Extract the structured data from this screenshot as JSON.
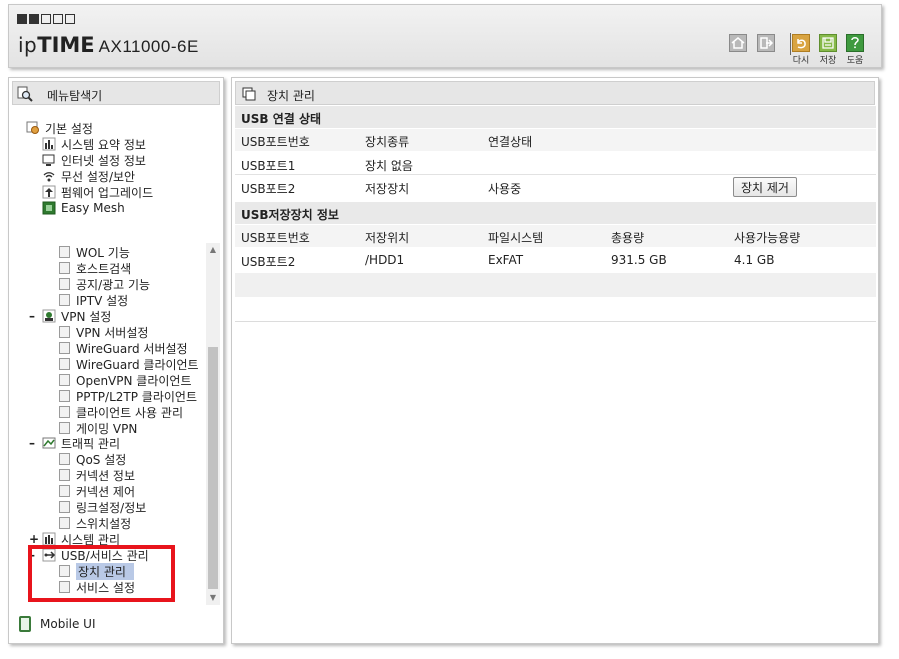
{
  "header": {
    "brand_ip": "ip",
    "brand_time": "TIME",
    "model": "AX11000-6E",
    "buttons": [
      {
        "name": "home",
        "icon": "home-icon"
      },
      {
        "name": "logout",
        "icon": "logout-icon"
      },
      {
        "name": "reload",
        "icon": "undo-icon",
        "label": "다시",
        "color": "#d9a441"
      },
      {
        "name": "save",
        "icon": "save-icon",
        "label": "저장",
        "color": "#86b94a"
      },
      {
        "name": "help",
        "icon": "help-icon",
        "label": "도움",
        "color": "#3f9a3f"
      }
    ]
  },
  "sidebar": {
    "title": "메뉴탐색기",
    "top_group": {
      "label": "기본 설정",
      "items": [
        "시스템 요약 정보",
        "인터넷 설정 정보",
        "무선 설정/보안",
        "펌웨어 업그레이드",
        "Easy Mesh"
      ]
    },
    "scroll": {
      "pre_items": [
        "WOL 기능",
        "호스트검색",
        "공지/광고 기능",
        "IPTV 설정"
      ],
      "vpn": {
        "label": "VPN 설정",
        "items": [
          "VPN 서버설정",
          "WireGuard 서버설정",
          "WireGuard 클라이언트",
          "OpenVPN 클라이언트",
          "PPTP/L2TP 클라이언트",
          "클라이언트 사용 관리",
          "게이밍 VPN"
        ]
      },
      "traffic": {
        "label": "트래픽 관리",
        "items": [
          "QoS 설정",
          "커넥션 정보",
          "커넥션 제어",
          "링크설정/정보",
          "스위치설정"
        ]
      },
      "system": {
        "label": "시스템 관리"
      },
      "usb": {
        "label": "USB/서비스 관리",
        "items": [
          "장치 관리",
          "서비스 설정"
        ],
        "selected": "장치 관리"
      }
    },
    "mobile_ui": "Mobile UI"
  },
  "main": {
    "title": "장치 관리",
    "usb_status": {
      "heading": "USB 연결 상태",
      "columns": [
        "USB포트번호",
        "장치종류",
        "연결상태"
      ],
      "rows": [
        {
          "port": "USB포트1",
          "type": "장치 없음",
          "status": ""
        },
        {
          "port": "USB포트2",
          "type": "저장장치",
          "status": "사용중",
          "action": "장치 제거"
        }
      ]
    },
    "storage": {
      "heading": "USB저장장치 정보",
      "columns": [
        "USB포트번호",
        "저장위치",
        "파일시스템",
        "총용량",
        "사용가능용량"
      ],
      "rows": [
        {
          "port": "USB포트2",
          "location": "/HDD1",
          "fs": "ExFAT",
          "total": "931.5 GB",
          "free": "4.1 GB"
        }
      ]
    }
  },
  "colors": {
    "highlight": "#e8141c",
    "selection": "#b9c9e6",
    "section_bg": "#e9e9e9"
  }
}
